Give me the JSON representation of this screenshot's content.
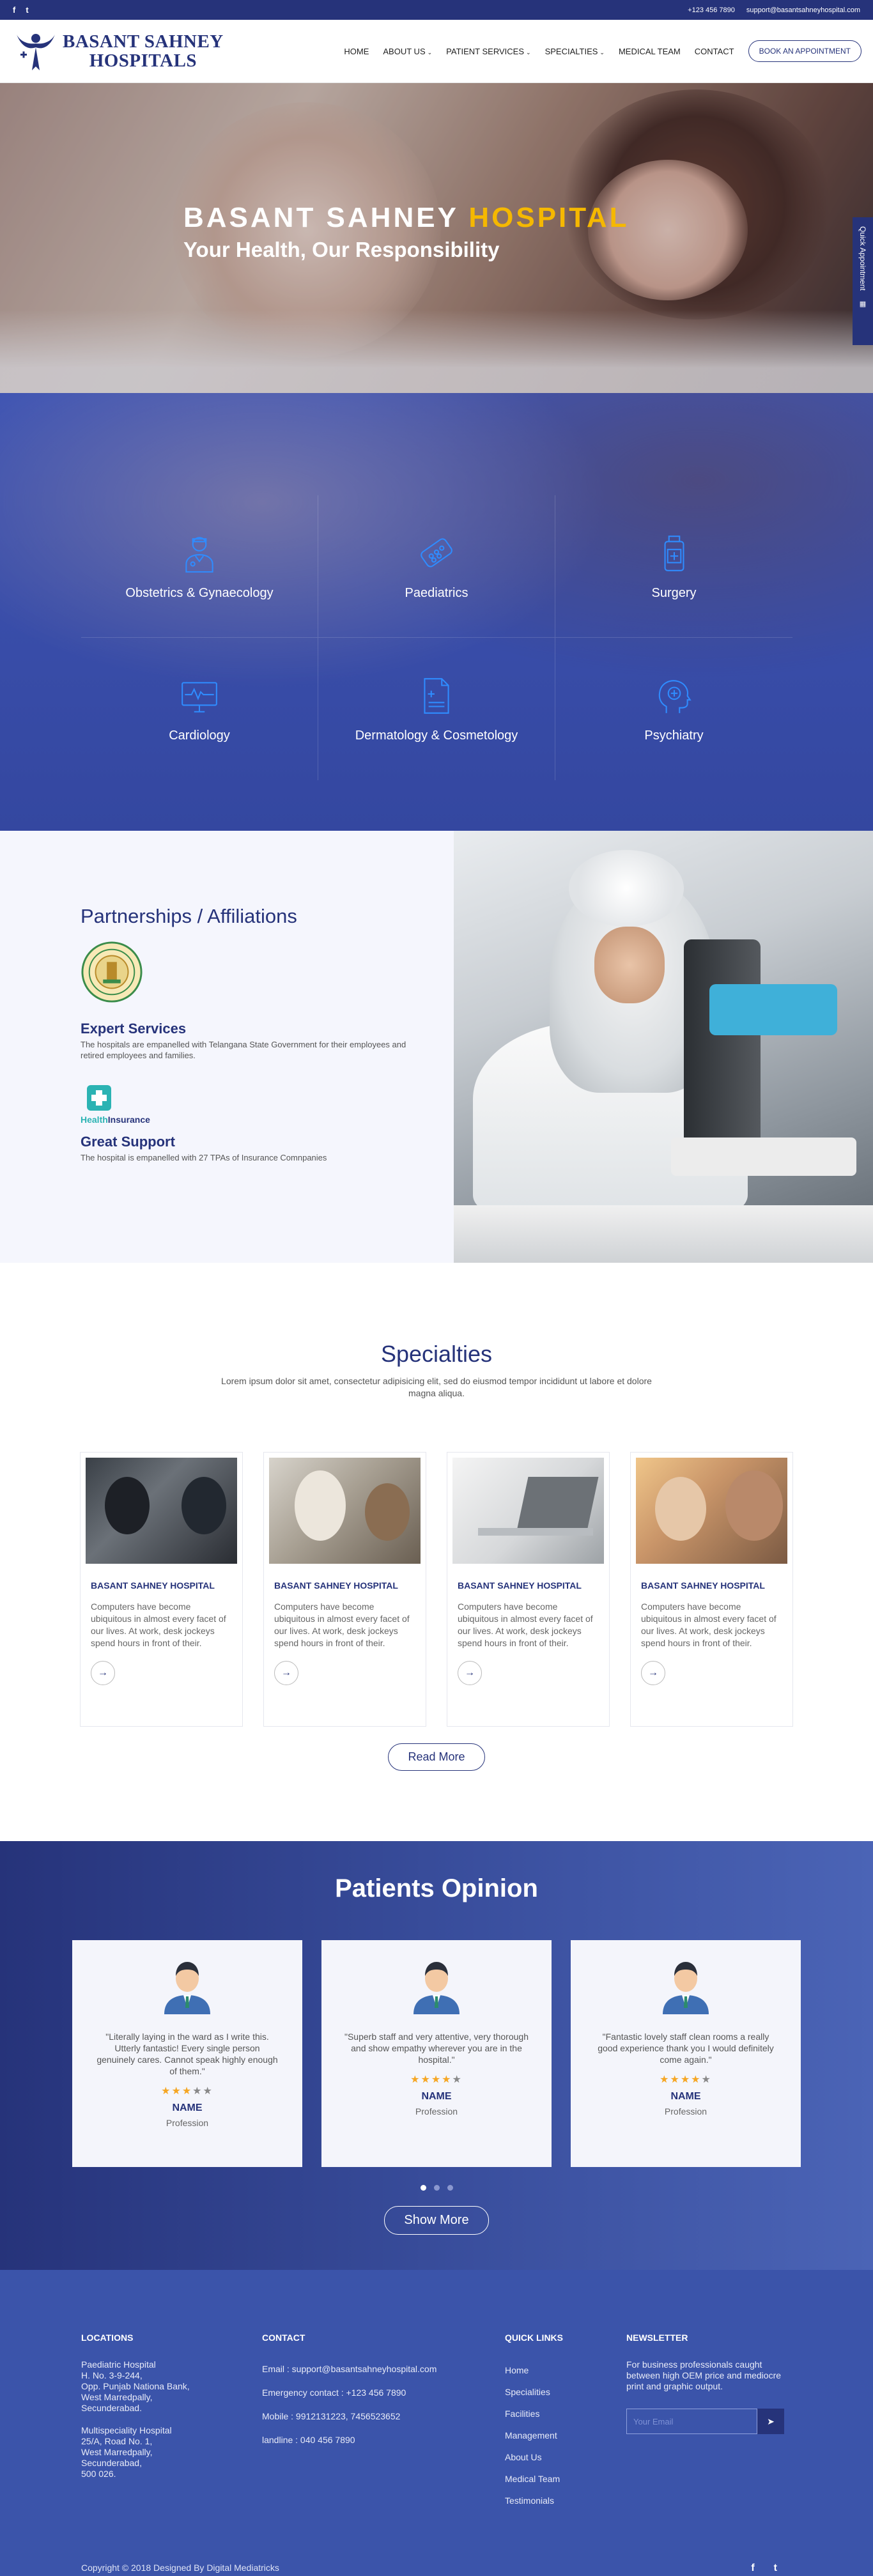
{
  "topbar": {
    "social": [
      "f",
      "t"
    ],
    "phone": "+123 456 7890",
    "email": "support@basantsahneyhospital.com"
  },
  "header": {
    "brand_line1": "BASANT SAHNEY",
    "brand_line2": "HOSPITALS",
    "nav": [
      {
        "label": "HOME",
        "caret": false
      },
      {
        "label": "ABOUT US",
        "caret": true
      },
      {
        "label": "PATIENT SERVICES",
        "caret": true
      },
      {
        "label": "SPECIALTIES",
        "caret": true
      },
      {
        "label": "MEDICAL TEAM",
        "caret": false
      },
      {
        "label": "CONTACT",
        "caret": false
      }
    ],
    "cta": "BOOK AN APPOINTMENT"
  },
  "hero": {
    "title_main": "BASANT SAHNEY",
    "title_accent": "HOSPITAL",
    "subtitle": "Your Health, Our Responsibility",
    "quick_tab": "Quick Appointment"
  },
  "specialty_grid": [
    {
      "label": "Obstetrics & Gynaecology",
      "icon": "doctor-icon"
    },
    {
      "label": "Paediatrics",
      "icon": "pills-icon"
    },
    {
      "label": "Surgery",
      "icon": "medicine-bottle-icon"
    },
    {
      "label": "Cardiology",
      "icon": "heart-monitor-icon"
    },
    {
      "label": "Dermatology & Cosmetology",
      "icon": "medical-report-icon"
    },
    {
      "label": "Psychiatry",
      "icon": "head-cross-icon"
    }
  ],
  "partnerships": {
    "title": "Partnerships / Affiliations",
    "item1_title": "Expert Services",
    "item1_text": "The hospitals are empanelled with Telangana State Government for their employees and retired employees and families.",
    "logo2_a": "Health",
    "logo2_b": "Insurance",
    "item2_title": "Great Support",
    "item2_text": "The hospital is empanelled with 27 TPAs of Insurance Comnpanies"
  },
  "specialties": {
    "title": "Specialties",
    "lead": "Lorem ipsum dolor sit amet, consectetur adipisicing elit, sed do eiusmod tempor incididunt ut labore et dolore magna aliqua.",
    "cards": [
      {
        "title": "BASANT SAHNEY HOSPITAL",
        "text": "Computers have become ubiquitous in almost every facet of our lives. At work, desk jockeys spend hours in front of their."
      },
      {
        "title": "BASANT SAHNEY HOSPITAL",
        "text": "Computers have become ubiquitous in almost every facet of our lives. At work, desk jockeys spend hours in front of their."
      },
      {
        "title": "BASANT SAHNEY HOSPITAL",
        "text": "Computers have become ubiquitous in almost every facet of our lives. At work, desk jockeys spend hours in front of their."
      },
      {
        "title": "BASANT SAHNEY HOSPITAL",
        "text": "Computers have become ubiquitous in almost every facet of our lives. At work, desk jockeys spend hours in front of their."
      }
    ],
    "read_more": "Read More"
  },
  "opinion": {
    "title": "Patients Opinion",
    "cards": [
      {
        "quote": "\"Literally laying in the ward as I write this. Utterly fantastic! Every single person genuinely cares. Cannot speak highly enough of them.\"",
        "rating": 3,
        "name": "NAME",
        "role": "Profession"
      },
      {
        "quote": "\"Superb staff and very attentive, very thorough and show empathy wherever you are in the hospital.\"",
        "rating": 4,
        "name": "NAME",
        "role": "Profession"
      },
      {
        "quote": "\"Fantastic lovely staff clean rooms a really good experience thank you I would definitely come again.\"",
        "rating": 4,
        "name": "NAME",
        "role": "Profession"
      }
    ],
    "dots": 3,
    "active_dot": 0,
    "show_more": "Show More"
  },
  "footer": {
    "locations_title": "LOCATIONS",
    "loc1": [
      "Paediatric Hospital",
      "H. No. 3-9-244,",
      "Opp. Punjab Nationa Bank,",
      "West Marredpally,",
      "Secunderabad."
    ],
    "loc2": [
      "Multispeciality Hospital",
      "25/A, Road No. 1,",
      "West Marredpally,",
      "Secunderabad,",
      "500 026."
    ],
    "contact_title": "CONTACT",
    "contact": [
      "Email : support@basantsahneyhospital.com",
      "Emergency contact : +123 456 7890",
      "Mobile : 9912131223, 7456523652",
      "landline : 040 456 7890"
    ],
    "links_title": "QUICK LINKS",
    "links": [
      "Home",
      "Specialities",
      "Facilities",
      "Management",
      "About Us",
      "Medical Team",
      "Testimonials"
    ],
    "newsletter_title": "NEWSLETTER",
    "newsletter_text": "For business professionals caught between high OEM price and mediocre print and graphic output.",
    "newsletter_placeholder": "Your Email",
    "copyright": "Copyright © 2018 Designed By Digital Mediatricks",
    "social": [
      "f",
      "t"
    ]
  },
  "colors": {
    "brand": "#26337a",
    "accent": "#f5b800",
    "grid_bg": "#3e54b3",
    "footer_bg": "#3b54aa",
    "icon_blue": "#2f6ee0"
  }
}
